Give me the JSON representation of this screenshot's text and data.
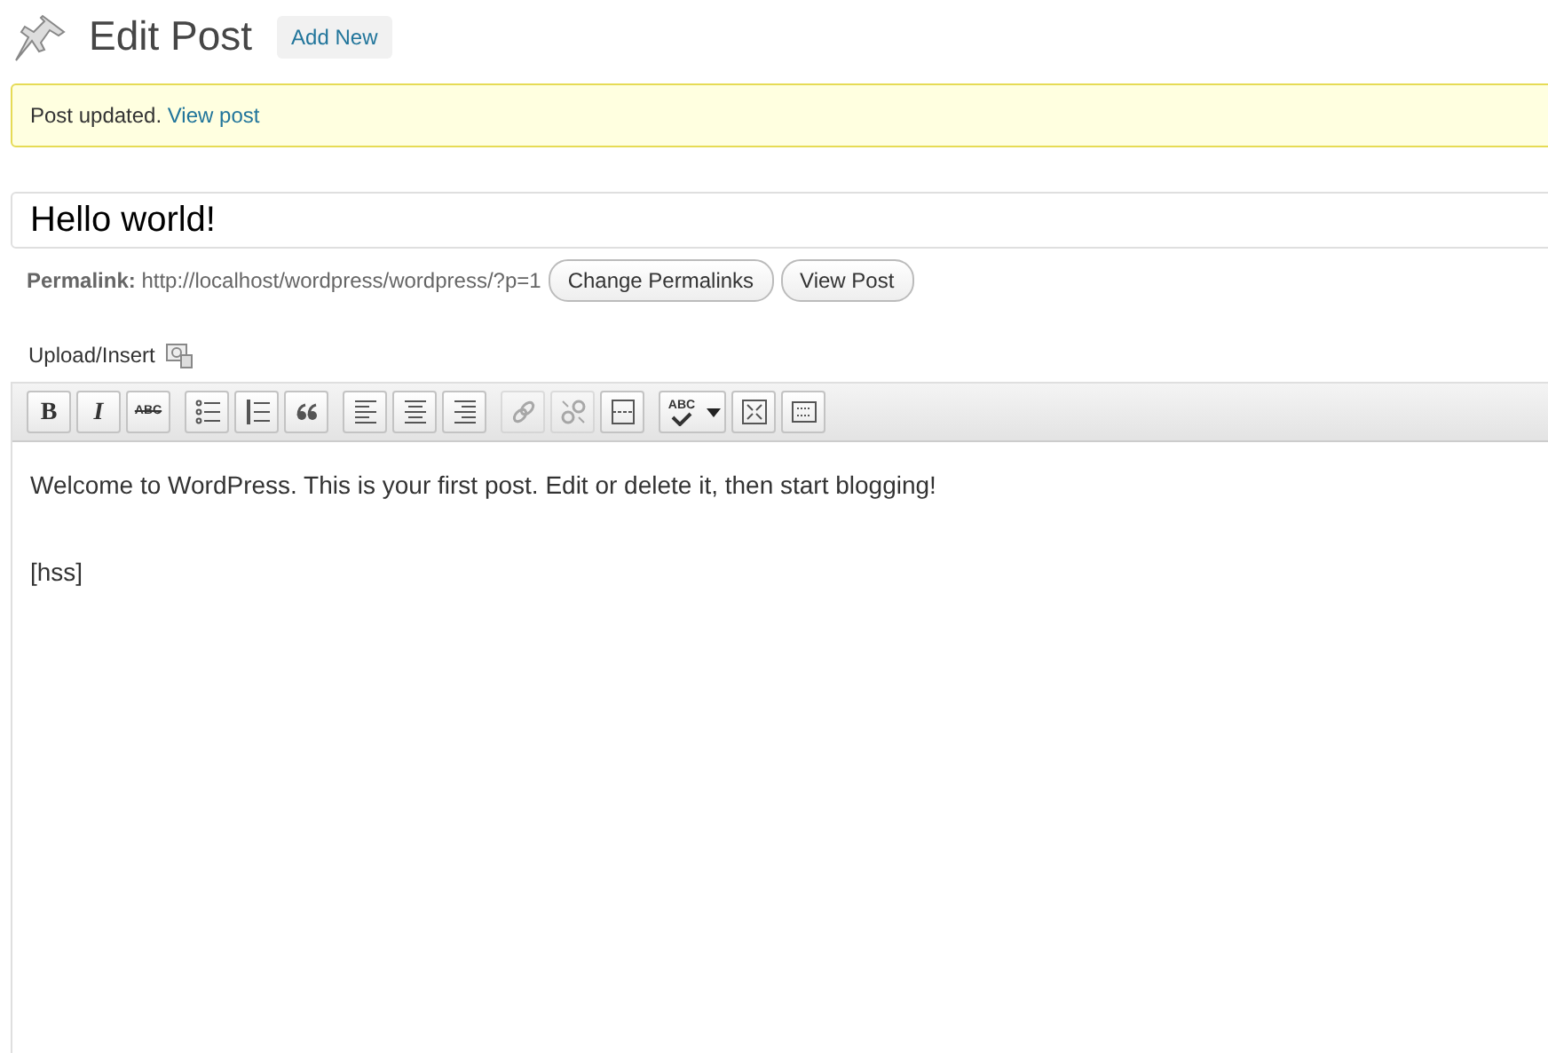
{
  "header": {
    "title": "Edit Post",
    "add_new": "Add New"
  },
  "notice": {
    "text": "Post updated.",
    "link": "View post"
  },
  "post_title": {
    "value": "Hello world!"
  },
  "permalink": {
    "label": "Permalink:",
    "url": "http://localhost/wordpress/wordpress/?p=1",
    "buttons": [
      "Change Permalinks",
      "View Post"
    ]
  },
  "upload_insert": {
    "label": "Upload/Insert"
  },
  "toolbar": [
    [
      {
        "kind": "bold",
        "label": "B",
        "disabled": false
      },
      {
        "kind": "italic",
        "label": "I",
        "disabled": false
      },
      {
        "kind": "strike",
        "label": "ABC",
        "disabled": false
      }
    ],
    [
      {
        "kind": "bullets",
        "disabled": false
      },
      {
        "kind": "numbers",
        "disabled": false
      },
      {
        "kind": "quote",
        "disabled": false
      }
    ],
    [
      {
        "kind": "align-left",
        "disabled": false
      },
      {
        "kind": "align-center",
        "disabled": false
      },
      {
        "kind": "align-right",
        "disabled": false
      }
    ],
    [
      {
        "kind": "link",
        "disabled": true
      },
      {
        "kind": "unlink",
        "disabled": true
      },
      {
        "kind": "more",
        "disabled": false
      }
    ],
    [
      {
        "kind": "spell",
        "label": "ABC",
        "disabled": false
      },
      {
        "kind": "fullscreen",
        "disabled": false
      },
      {
        "kind": "kitchen",
        "disabled": false
      }
    ]
  ],
  "content": [
    "Welcome to WordPress. This is your first post. Edit or delete it, then start blogging!",
    "[hss]"
  ]
}
